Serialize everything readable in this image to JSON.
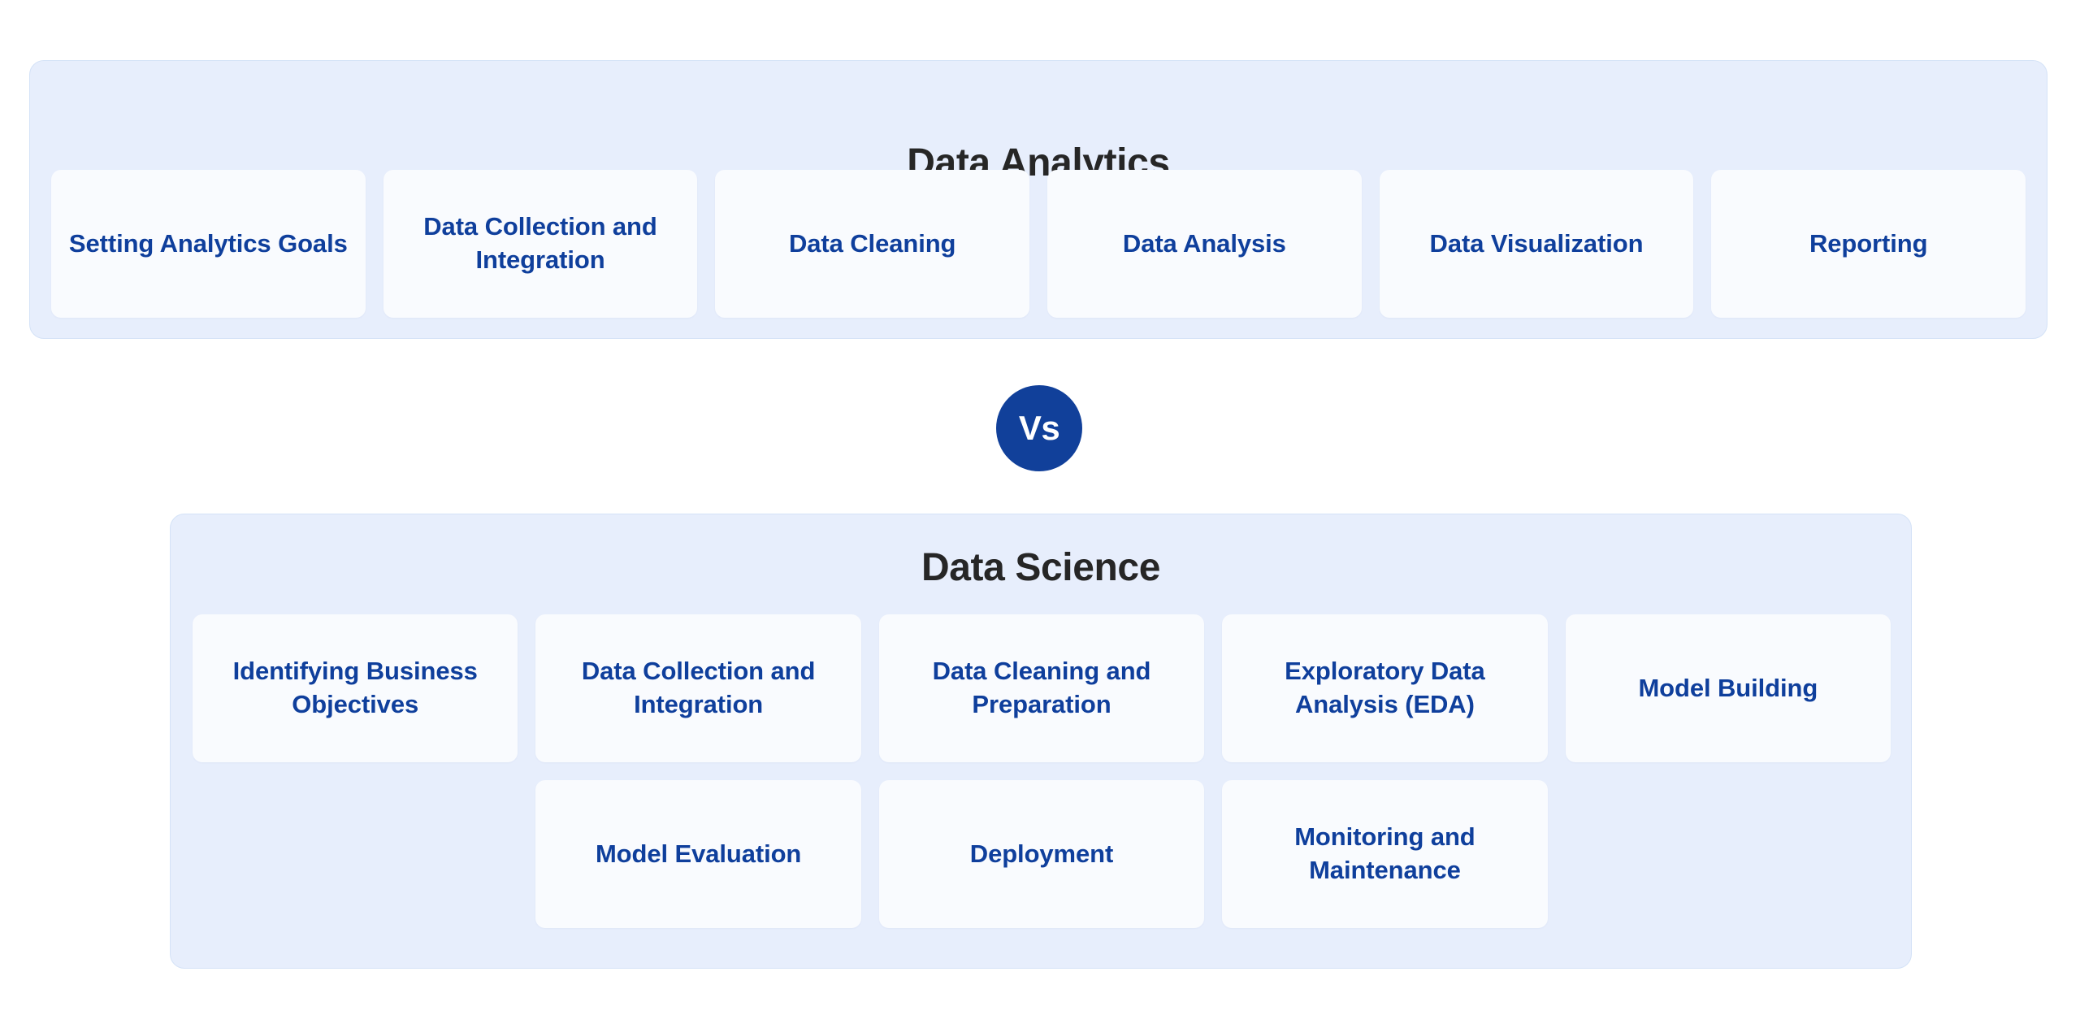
{
  "diagram": {
    "title": "Data Analytics vs Data Science",
    "type": "comparison",
    "accent_color": "#11409a",
    "panel_background": "#e7eefc",
    "card_background": "#f9fbfe",
    "card_text_color": "#0f3f9c",
    "heading_text_color": "#262626"
  },
  "analytics": {
    "heading": "Data Analytics",
    "steps": [
      {
        "label": "Setting Analytics Goals"
      },
      {
        "label": "Data Collection and Integration"
      },
      {
        "label": "Data Cleaning"
      },
      {
        "label": "Data Analysis"
      },
      {
        "label": "Data Visualization"
      },
      {
        "label": "Reporting"
      }
    ]
  },
  "separator": {
    "label": "Vs"
  },
  "science": {
    "heading": "Data Science",
    "row1": [
      {
        "label": "Identifying Business Objectives"
      },
      {
        "label": "Data Collection and Integration"
      },
      {
        "label": "Data Cleaning and Preparation"
      },
      {
        "label": "Exploratory Data Analysis (EDA)"
      },
      {
        "label": "Model Building"
      }
    ],
    "row2": [
      {
        "label": ""
      },
      {
        "label": "Model Evaluation"
      },
      {
        "label": "Deployment"
      },
      {
        "label": "Monitoring and Maintenance"
      },
      {
        "label": ""
      }
    ]
  }
}
